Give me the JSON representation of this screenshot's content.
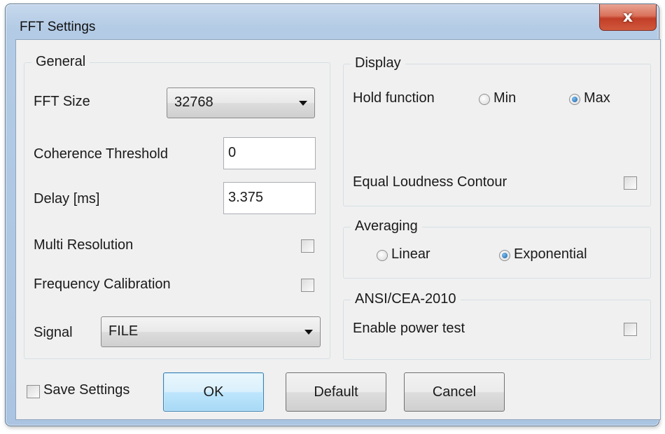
{
  "window": {
    "title": "FFT Settings",
    "close_glyph": "x",
    "accent_color": "#c13e27"
  },
  "general": {
    "legend": "General",
    "fft_size_label": "FFT Size",
    "fft_size_value": "32768",
    "coherence_label": "Coherence Threshold",
    "coherence_value": "0",
    "delay_label": "Delay [ms]",
    "delay_value": "3.375",
    "multi_resolution_label": "Multi Resolution",
    "multi_resolution_checked": false,
    "freq_calibration_label": "Frequency Calibration",
    "freq_calibration_checked": false,
    "signal_label": "Signal",
    "signal_value": "FILE"
  },
  "display": {
    "legend": "Display",
    "hold_function_label": "Hold function",
    "hold_options": [
      "Min",
      "Max"
    ],
    "hold_selected": "Max",
    "equal_loudness_label": "Equal Loudness Contour",
    "equal_loudness_checked": false
  },
  "averaging": {
    "legend": "Averaging",
    "options": [
      "Linear",
      "Exponential"
    ],
    "selected": "Exponential"
  },
  "ansi": {
    "legend": "ANSI/CEA-2010",
    "enable_power_test_label": "Enable power test",
    "enable_power_test_checked": false
  },
  "footer": {
    "save_settings_label": "Save Settings",
    "save_settings_checked": false,
    "ok_label": "OK",
    "default_label": "Default",
    "cancel_label": "Cancel"
  }
}
